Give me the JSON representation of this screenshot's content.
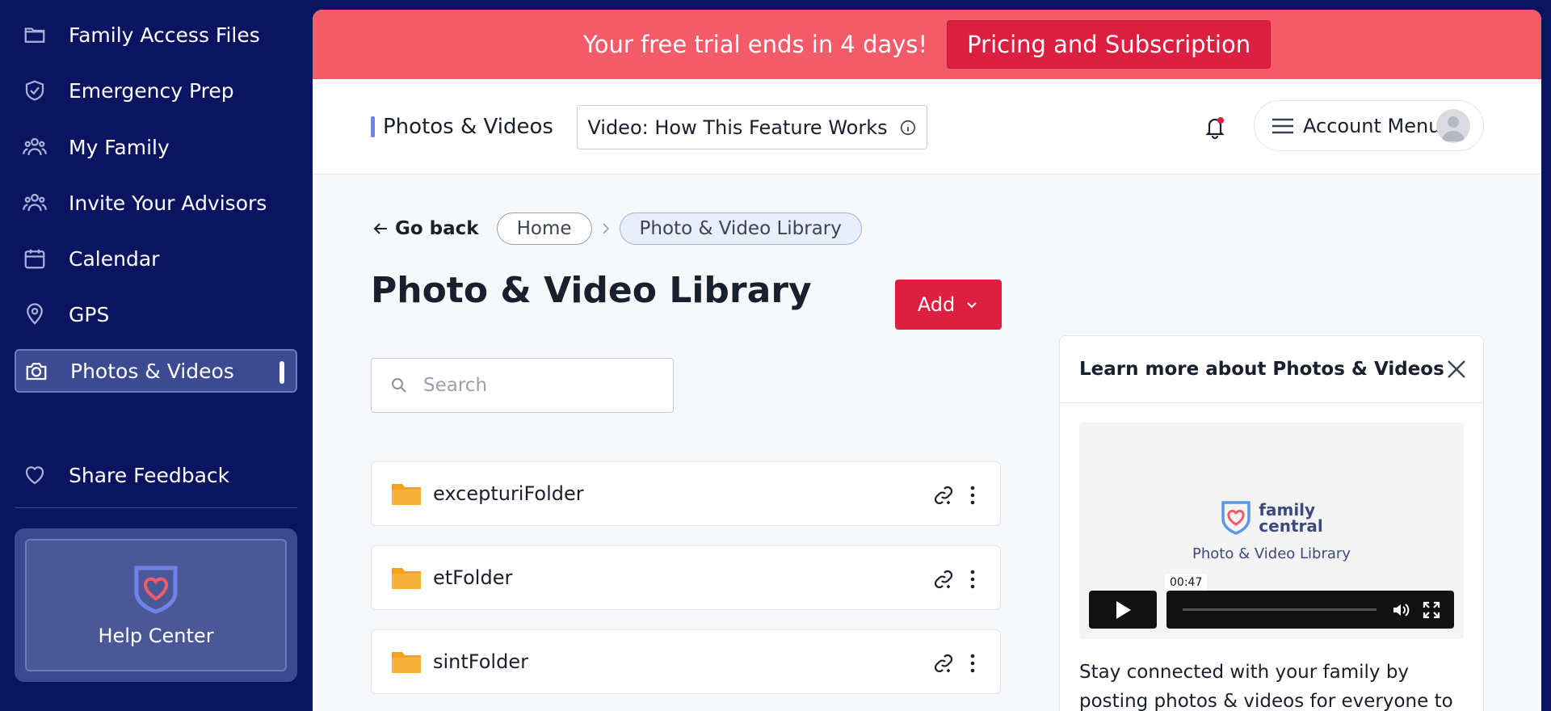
{
  "sidebar": {
    "items": [
      {
        "label": "Family Access Files",
        "icon": "folder-icon"
      },
      {
        "label": "Emergency Prep",
        "icon": "shield-icon"
      },
      {
        "label": "My Family",
        "icon": "family-icon"
      },
      {
        "label": "Invite Your Advisors",
        "icon": "people-icon"
      },
      {
        "label": "Calendar",
        "icon": "calendar-icon"
      },
      {
        "label": "GPS",
        "icon": "location-pin-icon"
      },
      {
        "label": "Photos & Videos",
        "icon": "camera-icon",
        "active": true
      },
      {
        "label": "Share Feedback",
        "icon": "heart-icon"
      }
    ],
    "help": {
      "label": "Help Center",
      "icon": "heart-shield-icon"
    }
  },
  "trial_banner": {
    "text": "Your free trial ends in 4 days!",
    "button": "Pricing and Subscription",
    "bg_color": "#f45b69",
    "button_color": "#dc1e40"
  },
  "header": {
    "title": "Photos & Videos",
    "video_button": "Video: How This Feature Works",
    "account_menu": "Account Menu"
  },
  "breadcrumb": {
    "back": "Go back",
    "items": [
      "Home",
      "Photo & Video Library"
    ]
  },
  "main": {
    "title": "Photo & Video Library",
    "add_button": "Add",
    "search_placeholder": "Search",
    "folders": [
      {
        "name": "excepturiFolder"
      },
      {
        "name": "etFolder"
      },
      {
        "name": "sintFolder"
      }
    ]
  },
  "learn_panel": {
    "title": "Learn more about Photos & Videos",
    "brand_line1": "family",
    "brand_line2": "central",
    "video_subtitle": "Photo & Video Library",
    "video_time": "00:47",
    "description": "Stay connected with your family by posting photos & videos for everyone to enjoy!"
  },
  "colors": {
    "sidebar_bg": "#0a1461",
    "accent_red": "#dc1e40",
    "folder_yellow": "#f5a11a",
    "chat_blue": "#1e7fd0"
  }
}
